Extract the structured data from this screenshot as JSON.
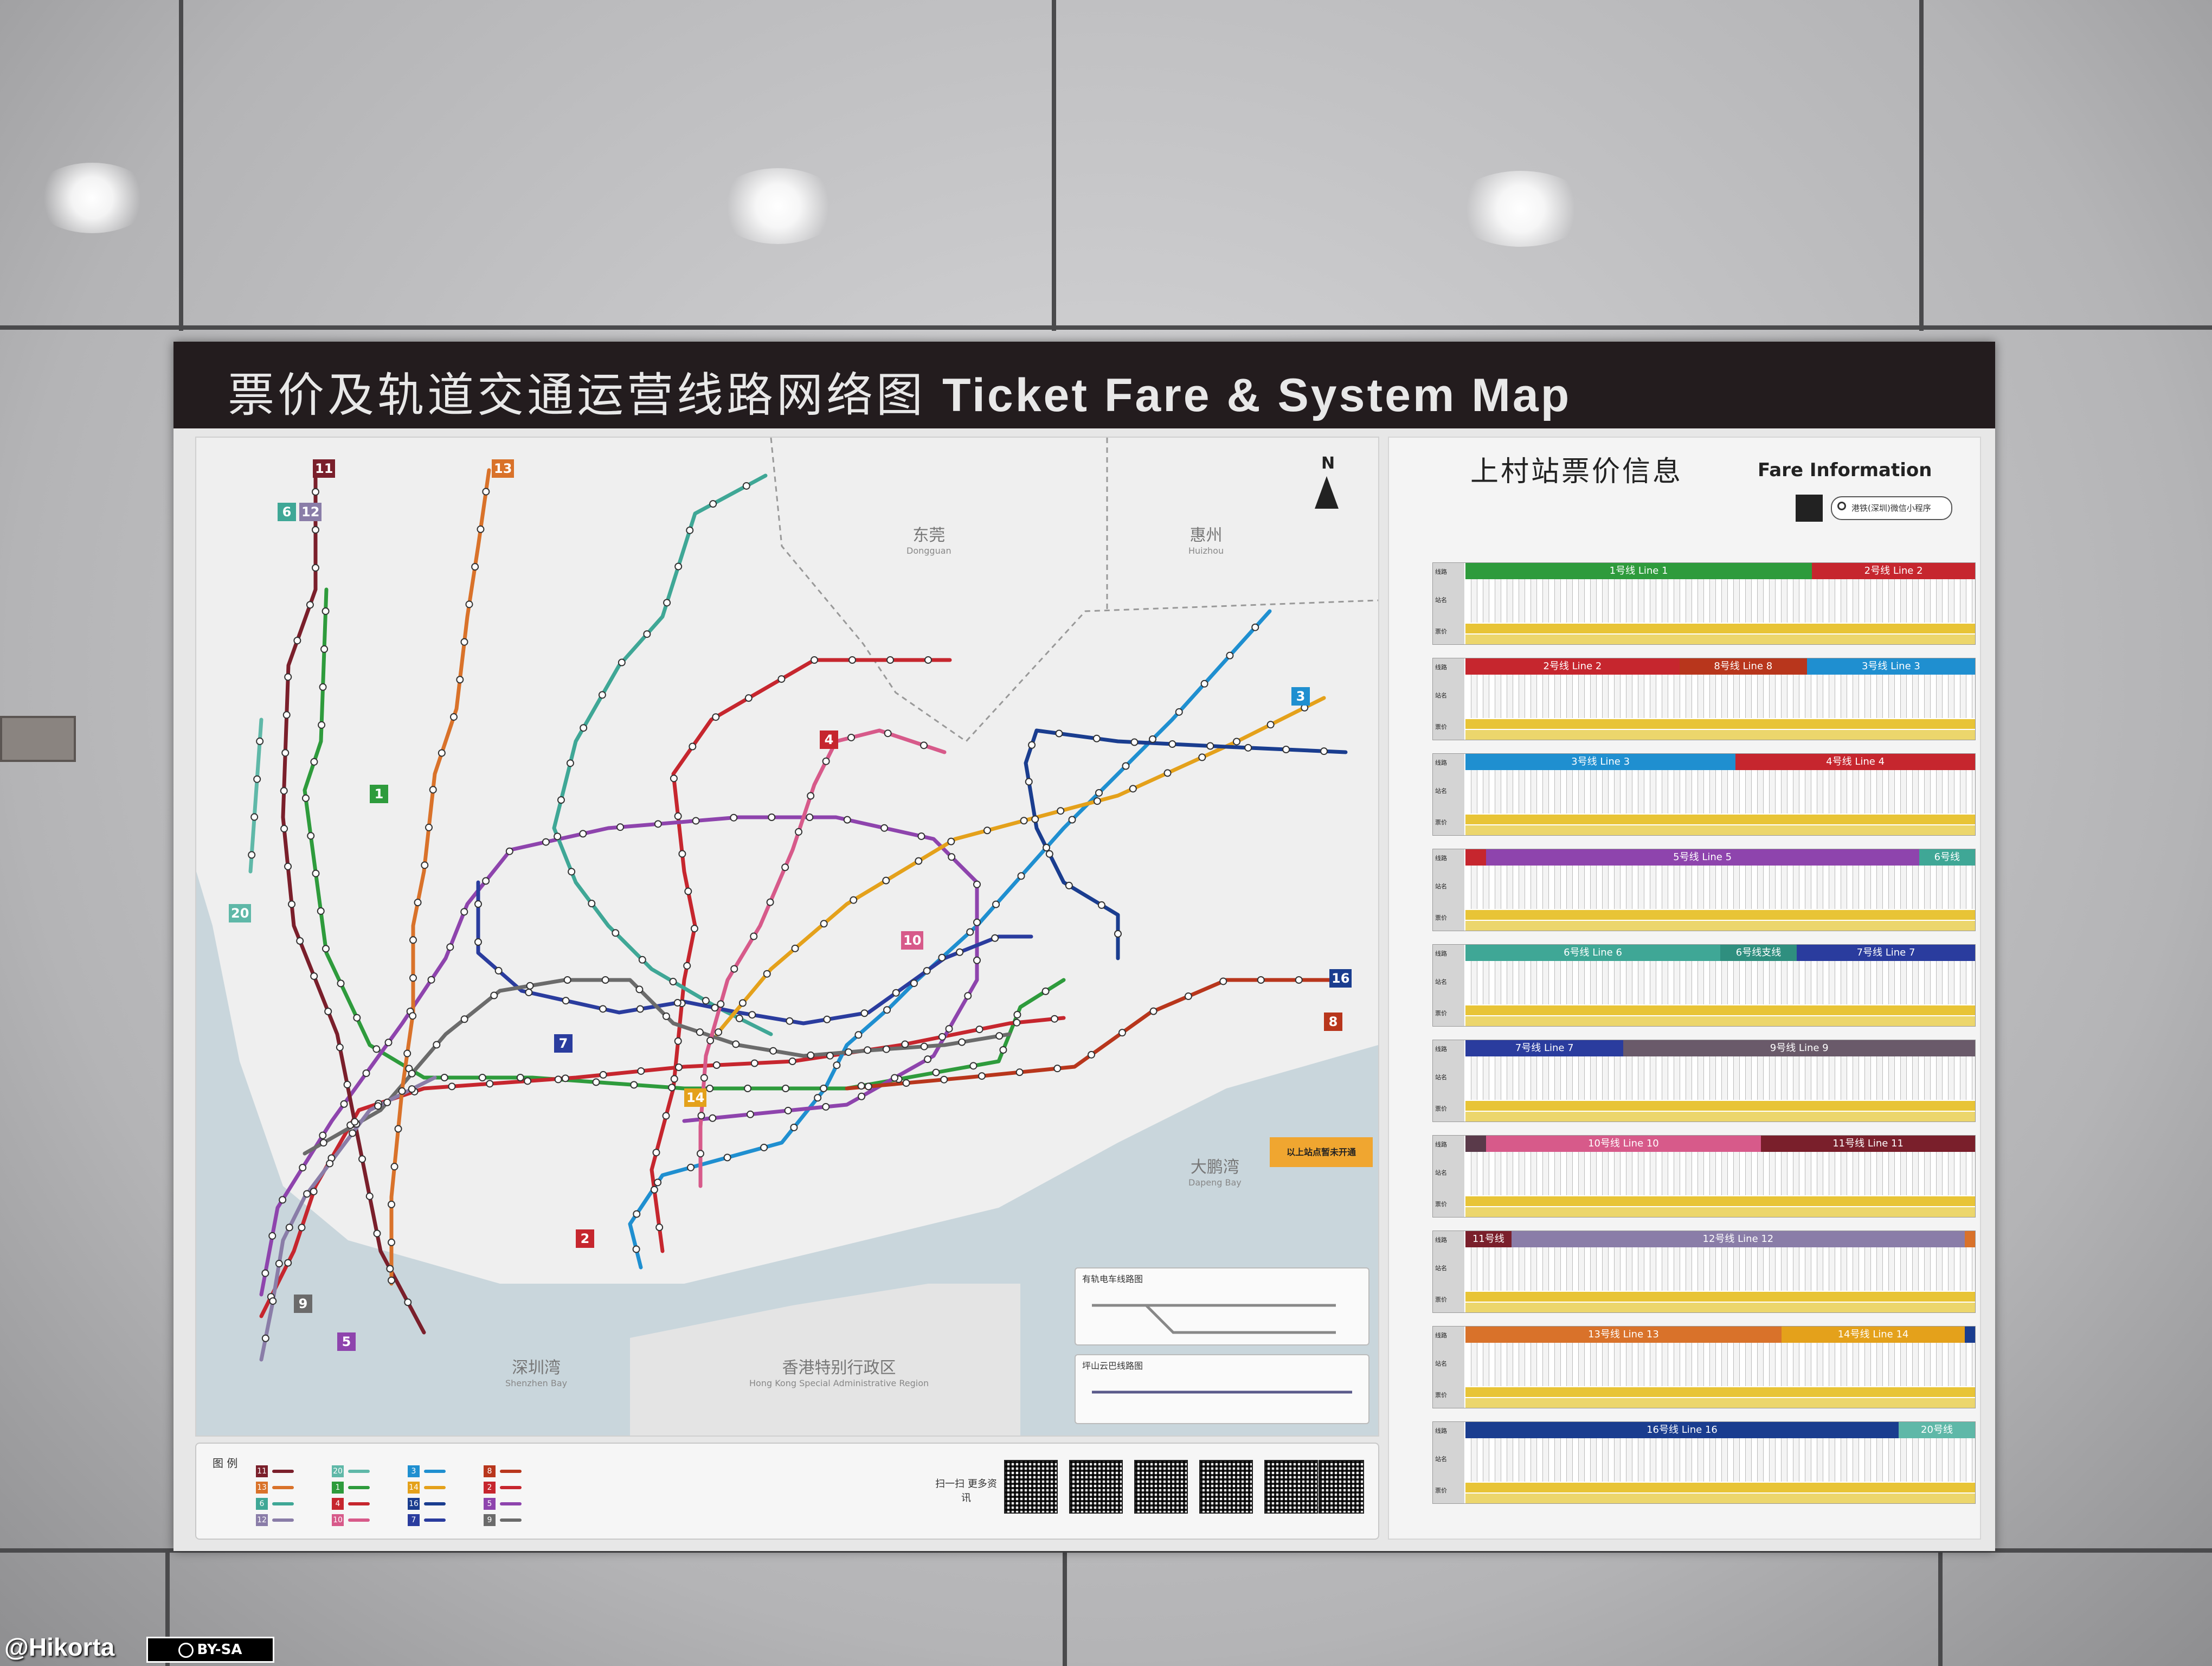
{
  "header": {
    "title_zh": "票价及轨道交通运营线路网络图",
    "title_en": "Ticket Fare & System Map"
  },
  "map": {
    "north": "N",
    "regions": {
      "dongguan": "东莞",
      "dongguan_en": "Dongguan",
      "huizhou": "惠州",
      "huizhou_en": "Huizhou",
      "dapeng": "大鹏湾",
      "dapeng_en": "Dapeng Bay",
      "shenzhen_bay": "深圳湾",
      "shenzhen_bay_en": "Shenzhen Bay",
      "hk": "香港特别行政区",
      "hk_en": "Hong Kong Special Administrative Region"
    },
    "tram_title": "有轨电车线路图",
    "bus_title": "坪山云巴线路图",
    "warning": "以上站点暂未开通",
    "badges": [
      {
        "label": "11",
        "color": "#7a1f2b"
      },
      {
        "label": "13",
        "color": "#d9722a"
      },
      {
        "label": "6",
        "color": "#3fa796"
      },
      {
        "label": "12",
        "color": "#8a7da8"
      },
      {
        "label": "20",
        "color": "#5fb8a8"
      },
      {
        "label": "1",
        "color": "#2e9b3c"
      },
      {
        "label": "4",
        "color": "#c6262e"
      },
      {
        "label": "10",
        "color": "#d75a8a"
      },
      {
        "label": "3",
        "color": "#1f8fd0"
      },
      {
        "label": "14",
        "color": "#e4a11b"
      },
      {
        "label": "16",
        "color": "#1a3d8f"
      },
      {
        "label": "7",
        "color": "#2a3c9e"
      },
      {
        "label": "8",
        "color": "#b8361c"
      },
      {
        "label": "2",
        "color": "#c6262e"
      },
      {
        "label": "5",
        "color": "#8e44ad"
      },
      {
        "label": "9",
        "color": "#6b6b6b"
      }
    ],
    "line_colors": {
      "l1": "#2e9b3c",
      "l2": "#c6262e",
      "l3": "#1f8fd0",
      "l4": "#c6262e",
      "l5": "#8e44ad",
      "l6": "#3fa796",
      "l7": "#2a3c9e",
      "l8": "#b8361c",
      "l9": "#6b6b6b",
      "l10": "#d75a8a",
      "l11": "#7a1f2b",
      "l12": "#8a7da8",
      "l13": "#d9722a",
      "l14": "#e4a11b",
      "l16": "#1a3d8f",
      "l20": "#5fb8a8"
    }
  },
  "legend": {
    "title": "图 例",
    "scan": "扫一扫 更多资讯"
  },
  "fare": {
    "title": "上村站票价信息",
    "title_en": "Fare Information",
    "search": "港铁(深圳)微信小程序",
    "row_labels": [
      "线路",
      "站名",
      "票价"
    ],
    "tables": [
      {
        "segments": [
          {
            "label": "1号线 Line 1",
            "color": "#2e9b3c",
            "w": 0.68
          },
          {
            "label": "2号线 Line 2",
            "color": "#c6262e",
            "w": 0.32
          }
        ]
      },
      {
        "segments": [
          {
            "label": "2号线 Line 2",
            "color": "#c6262e",
            "w": 0.42
          },
          {
            "label": "8号线 Line 8",
            "color": "#b8361c",
            "w": 0.25
          },
          {
            "label": "3号线 Line 3",
            "color": "#1f8fd0",
            "w": 0.33
          }
        ]
      },
      {
        "segments": [
          {
            "label": "3号线 Line 3",
            "color": "#1f8fd0",
            "w": 0.53
          },
          {
            "label": "4号线 Line 4",
            "color": "#c6262e",
            "w": 0.47
          }
        ]
      },
      {
        "segments": [
          {
            "label": "",
            "color": "#c6262e",
            "w": 0.04
          },
          {
            "label": "5号线 Line 5",
            "color": "#8e44ad",
            "w": 0.85
          },
          {
            "label": "6号线",
            "color": "#3fa796",
            "w": 0.11
          }
        ]
      },
      {
        "segments": [
          {
            "label": "6号线 Line 6",
            "color": "#3fa796",
            "w": 0.5
          },
          {
            "label": "6号线支线",
            "color": "#2f8f7f",
            "w": 0.15
          },
          {
            "label": "7号线 Line 7",
            "color": "#2a3c9e",
            "w": 0.35
          }
        ]
      },
      {
        "segments": [
          {
            "label": "7号线 Line 7",
            "color": "#2a3c9e",
            "w": 0.31
          },
          {
            "label": "9号线 Line 9",
            "color": "#6a5a6a",
            "w": 0.69
          }
        ]
      },
      {
        "segments": [
          {
            "label": "",
            "color": "#5a3a4a",
            "w": 0.04
          },
          {
            "label": "10号线 Line 10",
            "color": "#d75a8a",
            "w": 0.54
          },
          {
            "label": "11号线 Line 11",
            "color": "#7a1f2b",
            "w": 0.42
          }
        ]
      },
      {
        "segments": [
          {
            "label": "11号线",
            "color": "#7a1f2b",
            "w": 0.09
          },
          {
            "label": "12号线 Line 12",
            "color": "#8a7da8",
            "w": 0.89
          },
          {
            "label": "",
            "color": "#d9722a",
            "w": 0.02
          }
        ]
      },
      {
        "segments": [
          {
            "label": "13号线 Line 13",
            "color": "#d9722a",
            "w": 0.62
          },
          {
            "label": "14号线 Line 14",
            "color": "#e4a11b",
            "w": 0.36
          },
          {
            "label": "",
            "color": "#1a3d8f",
            "w": 0.02
          }
        ]
      },
      {
        "segments": [
          {
            "label": "16号线 Line 16",
            "color": "#1a3d8f",
            "w": 0.85
          },
          {
            "label": "20号线",
            "color": "#5fb8a8",
            "w": 0.15
          }
        ]
      }
    ]
  },
  "credit": {
    "author": "@Hikorta",
    "license": "BY-SA"
  }
}
